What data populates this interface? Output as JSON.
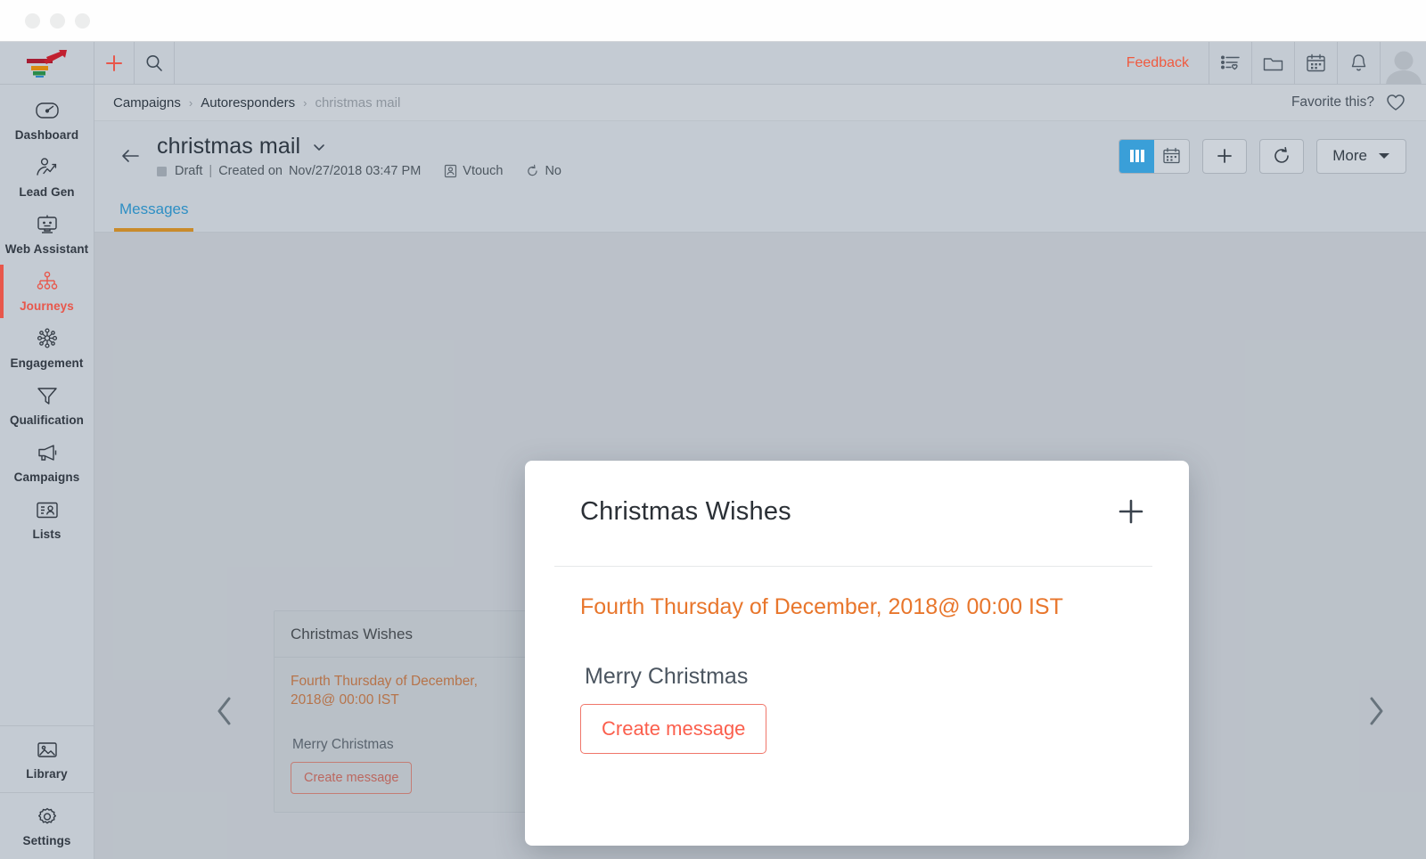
{
  "window": {
    "traffic_lights": [
      "close",
      "minimize",
      "zoom"
    ]
  },
  "sidebar": {
    "logo_name": "funnel-arrow-logo",
    "top_items": [
      {
        "label": "Dashboard",
        "icon": "gauge-icon",
        "active": false
      },
      {
        "label": "Lead Gen",
        "icon": "person-trend-icon",
        "active": false
      },
      {
        "label": "Web Assistant",
        "icon": "monitor-robot-icon",
        "active": false
      },
      {
        "label": "Journeys",
        "icon": "hierarchy-icon",
        "active": true
      },
      {
        "label": "Engagement",
        "icon": "network-node-icon",
        "active": false
      },
      {
        "label": "Qualification",
        "icon": "funnel-icon",
        "active": false
      },
      {
        "label": "Campaigns",
        "icon": "megaphone-icon",
        "active": false
      },
      {
        "label": "Lists",
        "icon": "contact-card-icon",
        "active": false
      }
    ],
    "bottom_items": [
      {
        "label": "Library",
        "icon": "image-icon",
        "active": false
      },
      {
        "label": "Settings",
        "icon": "gear-icon",
        "active": false
      }
    ],
    "active_color": "#e8574b"
  },
  "topbar": {
    "add_icon": "plus-icon",
    "search_icon": "search-icon",
    "feedback_label": "Feedback",
    "feedback_color": "#f05a3f",
    "icons": [
      {
        "name": "tasks-favorite-icon"
      },
      {
        "name": "folder-icon"
      },
      {
        "name": "calendar-icon"
      },
      {
        "name": "bell-icon"
      }
    ],
    "avatar_name": "user-avatar"
  },
  "breadcrumb": {
    "items": [
      {
        "label": "Campaigns",
        "current": false
      },
      {
        "label": "Autoresponders",
        "current": false
      },
      {
        "label": "christmas mail",
        "current": true
      }
    ],
    "separator": "›",
    "favorite_label": "Favorite this?",
    "favorite_icon": "heart-outline-icon"
  },
  "page_header": {
    "back_icon": "arrow-left-icon",
    "title": "christmas mail",
    "title_caret_icon": "chevron-down-icon",
    "status": "Draft",
    "created_prefix": "Created on",
    "created_on": "Nov/27/2018 03:47 PM",
    "owner_icon": "contact-icon",
    "owner": "Vtouch",
    "repeat_icon": "repeat-icon",
    "repeat": "No",
    "actions": {
      "view_columns_icon": "columns-view-icon",
      "view_calendar_icon": "calendar-view-icon",
      "active_view": "columns",
      "active_view_color": "#3a9fd8",
      "add_icon": "plus-icon",
      "refresh_icon": "refresh-icon",
      "more_label": "More",
      "more_caret_icon": "caret-down-icon"
    }
  },
  "tabs": [
    {
      "label": "Messages",
      "active": true
    }
  ],
  "tab_colors": {
    "text": "#2e8fc4",
    "underline": "#c98b2b"
  },
  "canvas": {
    "prev_icon": "chevron-left-icon",
    "next_icon": "chevron-right-icon",
    "background_card": {
      "title": "Christmas Wishes",
      "when": "Fourth Thursday of December, 2018@ 00:00 IST",
      "message": "Merry Christmas",
      "create_label": "Create message"
    }
  },
  "modal": {
    "title": "Christmas Wishes",
    "add_icon": "plus-icon",
    "when": "Fourth Thursday of December, 2018@ 00:00 IST",
    "when_color": "#e8762c",
    "message": "Merry Christmas",
    "create_label": "Create message",
    "create_color": "#fb5f4d"
  }
}
